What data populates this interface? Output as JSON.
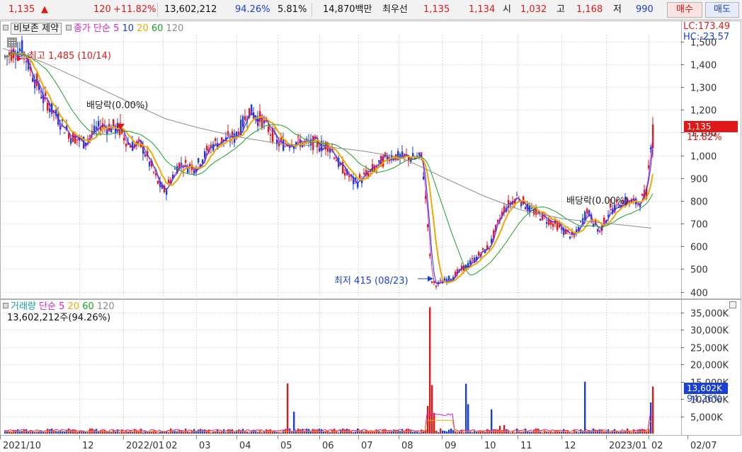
{
  "ticker": {
    "price": "1,135",
    "arrow": "▲",
    "change": "120",
    "change_pct": "+11.82%",
    "volume": "13,602,212",
    "vol_ratio": "94.26%",
    "turnover": "5.81%",
    "amount": "14,870백만",
    "quote_label": "최우선",
    "best_ask": "1,135",
    "best_bid": "1,134",
    "open_label": "시",
    "open": "1,032",
    "high_label": "고",
    "high": "1,168",
    "low_label": "저",
    "low": "990",
    "buy_label": "매수",
    "sell_label": "매도"
  },
  "price_panel": {
    "toggle_label": "비보존 제약",
    "legend_close": "종가",
    "legend_ma_type": "단순",
    "ma_periods": [
      "5",
      "10",
      "20",
      "60",
      "120"
    ],
    "lc_label": "LC:173.49",
    "hc_label": "HC:-23.57",
    "high_annotation": "최고 1,485 (10/14)",
    "low_annotation": "최저 415 (08/23)",
    "dividend_annotation_1": "배당락(0.00%)",
    "dividend_annotation_2": "배당락(0.00%)",
    "last_price_tag": "1,135",
    "last_change_tag": "11.82%",
    "y_ticks": [
      "1,500",
      "1,400",
      "1,300",
      "1,200",
      "1,100",
      "1,000",
      "900",
      "800",
      "700",
      "600",
      "500",
      "400"
    ]
  },
  "volume_panel": {
    "legend_title": "거래량",
    "legend_ma_type": "단순",
    "ma_periods": [
      "5",
      "20",
      "60",
      "120"
    ],
    "current_volume": "13,602,212주(94.26%)",
    "last_volume_tag": "13,602K",
    "last_ratio_tag": "94.26%",
    "y_ticks": [
      "35,000K",
      "30,000K",
      "25,000K",
      "20,000K",
      "15,000K",
      "10,000K",
      "5,000K"
    ]
  },
  "x_axis": {
    "labels": [
      "2021/10",
      "12",
      "2022/01",
      "02",
      "03",
      "04",
      "05",
      "06",
      "07",
      "08",
      "09",
      "10",
      "11",
      "12",
      "2023/01",
      "02",
      "02/07"
    ]
  },
  "colors": {
    "up": "#e01818",
    "down": "#1a3fd4",
    "ma5": "#d81ec8",
    "ma10": "#1a3fd4",
    "ma20": "#f0a800",
    "ma60": "#1aa02a",
    "ma120": "#8c8c8c",
    "price_tag_bg": "#e01818"
  },
  "chart_data": {
    "type": "candlestick",
    "title": "",
    "xlabel": "",
    "ylabel": "",
    "ylim": [
      380,
      1530
    ],
    "volume_ylim": [
      0,
      38000
    ],
    "x": [
      "2021/10",
      "2021/11",
      "2021/12",
      "2022/01",
      "2022/02",
      "2022/03",
      "2022/04",
      "2022/05",
      "2022/06",
      "2022/07",
      "2022/08",
      "2022/09",
      "2022/10",
      "2022/11",
      "2022/12",
      "2023/01",
      "2023/02"
    ],
    "close": [
      1430,
      1250,
      1080,
      1030,
      940,
      1060,
      1180,
      1060,
      1050,
      900,
      1000,
      470,
      620,
      790,
      650,
      780,
      1135
    ],
    "ma120": [
      1470,
      1410,
      1330,
      1240,
      1160,
      1120,
      1080,
      1050,
      1040,
      1020,
      990,
      900,
      820,
      760,
      720,
      700,
      680
    ],
    "volume_k": [
      1200,
      1500,
      900,
      1800,
      1000,
      1200,
      1700,
      14500,
      1000,
      1100,
      1200,
      36500,
      4500,
      1800,
      1200,
      1500,
      13602
    ]
  }
}
